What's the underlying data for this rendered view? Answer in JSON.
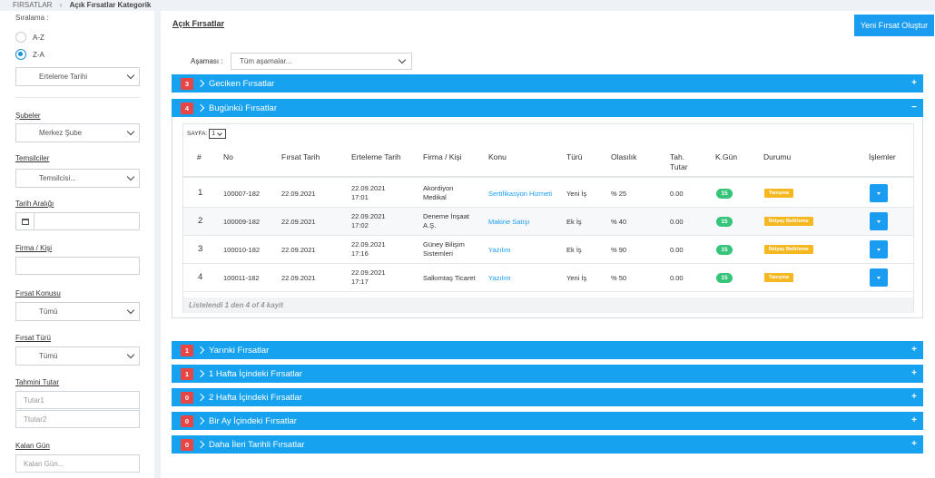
{
  "breadcrumb": {
    "root": "FIRSATLAR",
    "separator": "›",
    "current": "Açık Fırsatlar Kategorik"
  },
  "sidebar": {
    "sort_label": "Sıralama :",
    "sort_options": [
      {
        "label": "A-Z",
        "selected": false
      },
      {
        "label": "Z-A",
        "selected": true
      }
    ],
    "sort_field": "Erteleme Tarihi",
    "branches_label": "Şubeler",
    "branches_value": "Merkez Şube",
    "reps_label": "Temsilciler",
    "reps_value": "Temsilcisi...",
    "date_range_label": "Tarih Aralığı",
    "firm_label": "Firma / Kişi",
    "firm_value": "",
    "topic_label": "Fırsat Konusu",
    "topic_value": "Tümü",
    "type_label": "Fırsat Türü",
    "type_value": "Tümü",
    "amount_label": "Tahmini Tutar",
    "amount1_placeholder": "Tutar1",
    "amount2_placeholder": "Ttutar2",
    "remaining_label": "Kalan Gün",
    "remaining_placeholder": "Kalan Gün..."
  },
  "main": {
    "title": "Açık Fırsatlar",
    "new_button": "Yeni Fırsat Oluştur",
    "stage_label": "Aşaması :",
    "stage_value": "Tüm aşamalar...",
    "groups_top": [
      {
        "count": "3",
        "label": "Geciken Fırsatlar",
        "toggle": "+"
      },
      {
        "count": "4",
        "label": "Bugünkü Fırsatlar",
        "toggle": "−"
      }
    ],
    "groups_bottom": [
      {
        "count": "1",
        "label": "Yarınki Fırsatlar",
        "toggle": "+"
      },
      {
        "count": "1",
        "label": "1 Hafta İçindeki Fırsatlar",
        "toggle": "+"
      },
      {
        "count": "0",
        "label": "2 Hafta İçindeki Fırsatlar",
        "toggle": "+"
      },
      {
        "count": "0",
        "label": "Bir Ay İçindeki Fırsatlar",
        "toggle": "+"
      },
      {
        "count": "0",
        "label": "Daha İleri Tarihli Fırsatlar",
        "toggle": "+"
      }
    ],
    "table": {
      "page_label": "SAYFA:",
      "page_value": "1",
      "columns": [
        "#",
        "No",
        "Fırsat Tarih",
        "Erteleme Tarih",
        "Firma / Kişi",
        "Konu",
        "Türü",
        "Olasılık",
        "Tah. Tutar",
        "K.Gün",
        "Durumu",
        "İşlemler"
      ],
      "rows": [
        {
          "idx": "1",
          "no": "100007-182",
          "date": "22.09.2021",
          "defer": "22.09.2021 17:01",
          "firm": "Akordiyon Medikal",
          "topic": "Sertifikasyon Hizmeti",
          "type": "Yeni İş",
          "prob": "% 25",
          "amount": "0.00",
          "kgun": "15",
          "status": "Tanışma"
        },
        {
          "idx": "2",
          "no": "100009-182",
          "date": "22.09.2021",
          "defer": "22.09.2021 17:02",
          "firm": "Deneme İnşaat A.Ş.",
          "topic": "Makine Satışı",
          "type": "Ek İş",
          "prob": "% 40",
          "amount": "0.00",
          "kgun": "15",
          "status": "İhtiyaç Belirleme"
        },
        {
          "idx": "3",
          "no": "100010-182",
          "date": "22.09.2021",
          "defer": "22.09.2021 17:16",
          "firm": "Güney Bilişim Sistemleri",
          "topic": "Yazılım",
          "type": "Ek İş",
          "prob": "% 90",
          "amount": "0.00",
          "kgun": "15",
          "status": "İhtiyaç Belirleme"
        },
        {
          "idx": "4",
          "no": "100011-182",
          "date": "22.09.2021",
          "defer": "22.09.2021 17:17",
          "firm": "Salkımtaş Ticaret",
          "topic": "Yazılım",
          "type": "Yeni İş",
          "prob": "% 50",
          "amount": "0.00",
          "kgun": "15",
          "status": "Tanışma"
        }
      ],
      "footer": "Listelendi 1 den 4 of 4 kayit"
    }
  },
  "colors": {
    "accent": "#17a2ef",
    "badge": "#e84545",
    "kgun": "#36c47a",
    "status": "#f6b820"
  }
}
